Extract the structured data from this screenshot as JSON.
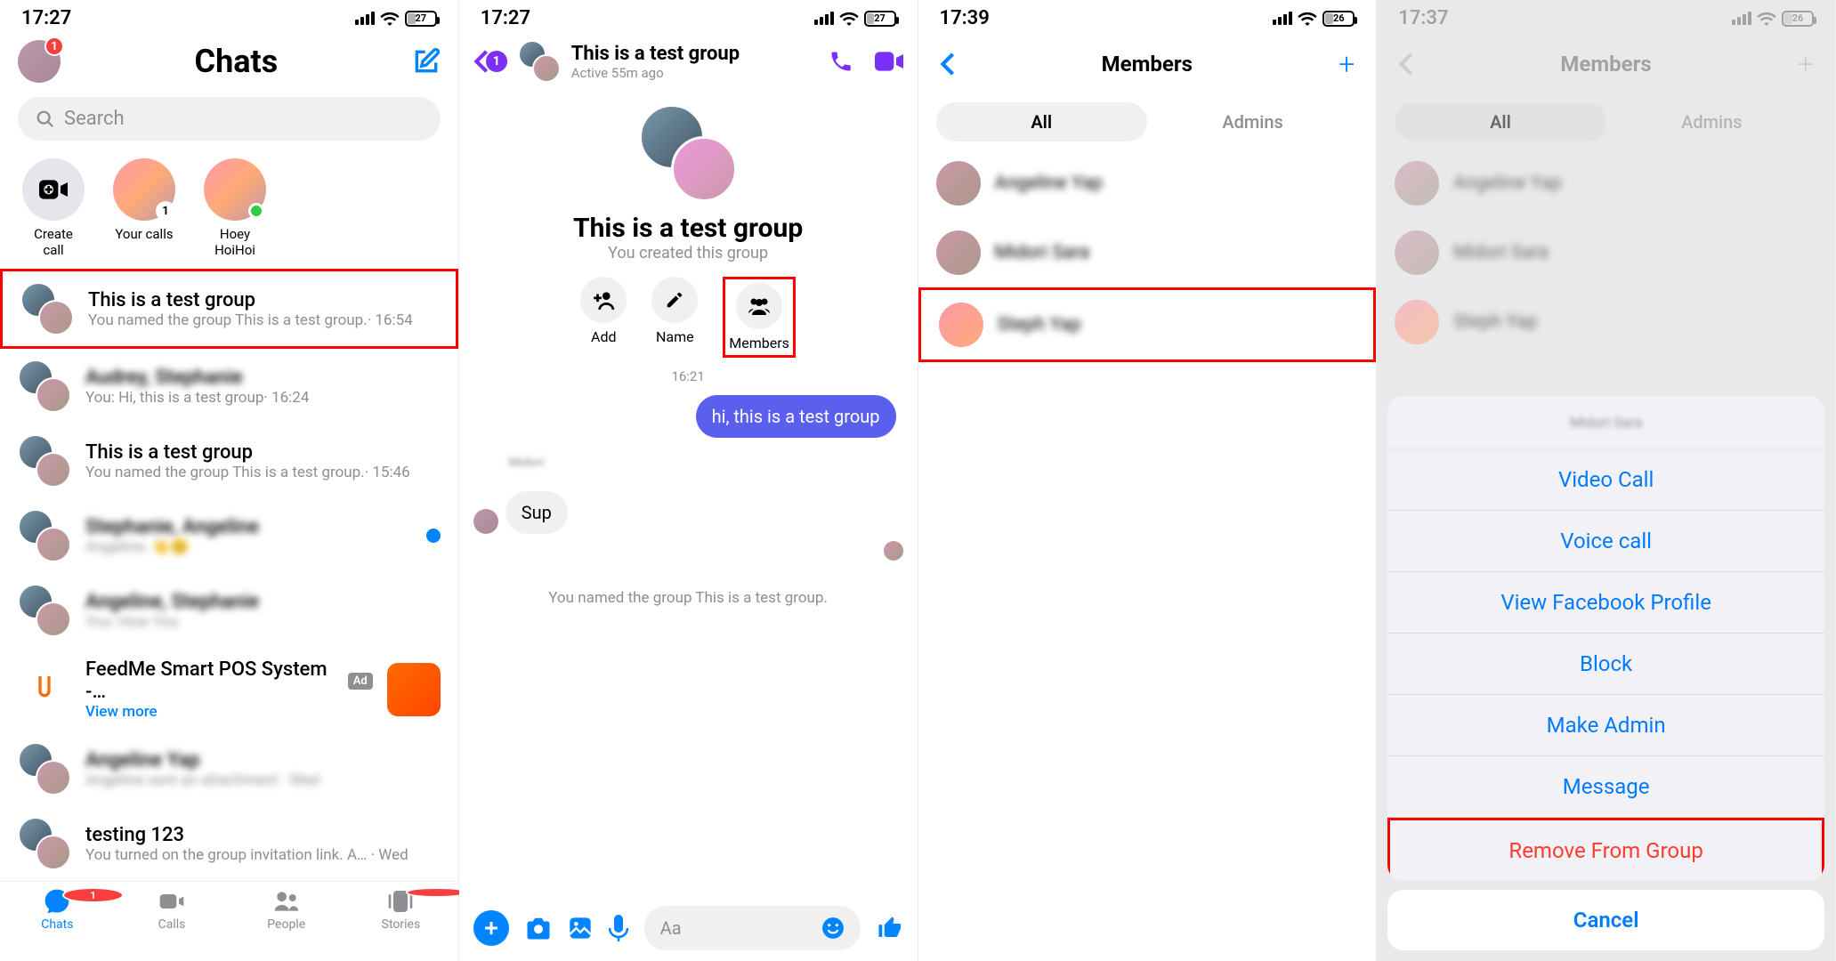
{
  "status": {
    "time1": "17:27",
    "time2": "17:27",
    "time3": "17:39",
    "time4": "17:37",
    "battery1": "27",
    "battery2": "27",
    "battery3": "26",
    "battery4": "26"
  },
  "s1": {
    "title": "Chats",
    "header_badge": "1",
    "search_placeholder": "Search",
    "stories": {
      "create_call": "Create\ncall",
      "your_calls": "Your calls",
      "hoey": "Hoey HoiHoi"
    },
    "chats": [
      {
        "title": "This is a test group",
        "sub": "You named the group This is a test group.· 16:54"
      },
      {
        "title": "Audrey, Stephanie",
        "sub": "You: Hi, this is a test group· 16:24"
      },
      {
        "title": "This is a test group",
        "sub": "You named the group This is a test group.· 15:46"
      },
      {
        "title": "Stephanie, Angeline",
        "sub": "Angeline: 👋😊"
      },
      {
        "title": "Angeline, Stephanie",
        "sub": "You: How You"
      },
      {
        "title": "FeedMe Smart POS System -…",
        "viewmore": "View more",
        "ad": "Ad"
      },
      {
        "title": "Angeline Yap",
        "sub": "Angeline sent an attachment · Wed"
      },
      {
        "title": "testing 123",
        "sub": "You turned on the group invitation link. A… · Wed"
      }
    ],
    "tabs": {
      "chats": "Chats",
      "calls": "Calls",
      "people": "People",
      "stories": "Stories"
    },
    "tab_badge": "1"
  },
  "s2": {
    "back_badge": "1",
    "title": "This is a test group",
    "active": "Active 55m ago",
    "big_title": "This is a test group",
    "big_sub": "You created this group",
    "actions": {
      "add": "Add",
      "name": "Name",
      "members": "Members"
    },
    "timestamp": "16:21",
    "sent_msg": "hi, this is a test group",
    "recv_name": "Midori",
    "recv_msg": "Sup",
    "sys_msg": "You named the group This is a test group.",
    "input_placeholder": "Aa"
  },
  "s3": {
    "title": "Members",
    "tab_all": "All",
    "tab_admins": "Admins",
    "members": [
      "Angeline Yap",
      "Midori Sara",
      "Steph Yap"
    ]
  },
  "s4": {
    "title": "Members",
    "tab_all": "All",
    "tab_admins": "Admins",
    "members": [
      "Angeline Yap",
      "Midori Sara",
      "Steph Yap"
    ],
    "sheet": {
      "header": "Midori Sara",
      "video": "Video Call",
      "voice": "Voice call",
      "profile": "View Facebook Profile",
      "block": "Block",
      "admin": "Make Admin",
      "message": "Message",
      "remove": "Remove From Group",
      "cancel": "Cancel"
    }
  }
}
